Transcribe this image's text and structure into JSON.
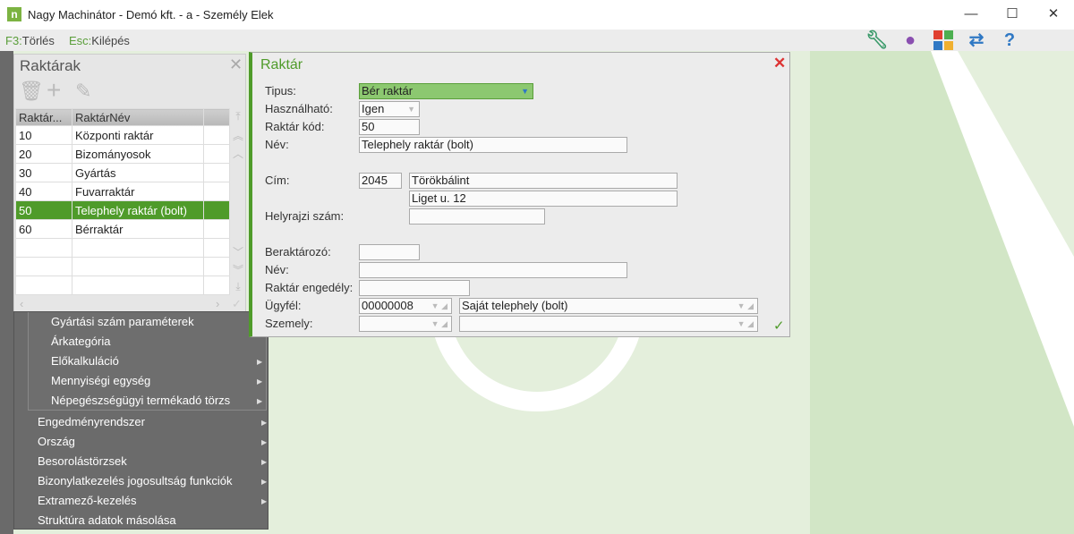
{
  "window": {
    "title": "Nagy Machinátor - Demó kft. - a - Személy Elek",
    "logo": "n"
  },
  "toolbar": {
    "keys": [
      {
        "key": "F3:",
        "label": "Törlés"
      },
      {
        "key": "Esc:",
        "label": "Kilépés"
      }
    ],
    "icons": [
      "wrench-icon",
      "user-icon",
      "modules-icon",
      "sync-icon",
      "help-icon"
    ]
  },
  "panel": {
    "title": "Raktárak",
    "columns": [
      "Raktár...",
      "RaktárNév"
    ],
    "rows": [
      [
        "10",
        "Központi raktár"
      ],
      [
        "20",
        "Bizományosok"
      ],
      [
        "30",
        "Gyártás"
      ],
      [
        "40",
        "Fuvarraktár"
      ],
      [
        "50",
        "Telephely raktár (bolt)"
      ],
      [
        "60",
        "Bérraktár"
      ]
    ],
    "selected_index": 4
  },
  "menu": {
    "sub_items": [
      "Gyártási szám paraméterek",
      "Árkategória",
      "Előkalkuláció",
      "Mennyiségi egység",
      "Népegészségügyi termékadó törzs"
    ],
    "items": [
      "Engedményrendszer",
      "Ország",
      "Besorolástörzsek",
      "Bizonylatkezelés jogosultság funkciók",
      "Extramező-kezelés",
      "Struktúra adatok másolása"
    ]
  },
  "dialog": {
    "title": "Raktár",
    "labels": {
      "tipus": "Tipus:",
      "hasznalhato": "Használható:",
      "kod": "Raktár kód:",
      "nev": "Név:",
      "cim": "Cím:",
      "hrsz": "Helyrajzi szám:",
      "berakt": "Beraktározó:",
      "nev2": "Név:",
      "engedely": "Raktár engedély:",
      "ugyfel": "Ügyfél:",
      "szemely": "Szemely:"
    },
    "values": {
      "tipus": "Bér raktár",
      "hasznalhato": "Igen",
      "kod": "50",
      "nev": "Telephely raktár (bolt)",
      "irsz": "2045",
      "varos": "Törökbálint",
      "utca": "Liget u. 12",
      "hrsz": "",
      "berakt": "",
      "nev2": "",
      "engedely": "",
      "ugyfel_kod": "00000008",
      "ugyfel_nev": "Saját telephely (bolt)",
      "szemely_kod": "",
      "szemely_nev": ""
    }
  },
  "colors": {
    "accent": "#4f9b2a",
    "select_bg": "#8cc870"
  }
}
